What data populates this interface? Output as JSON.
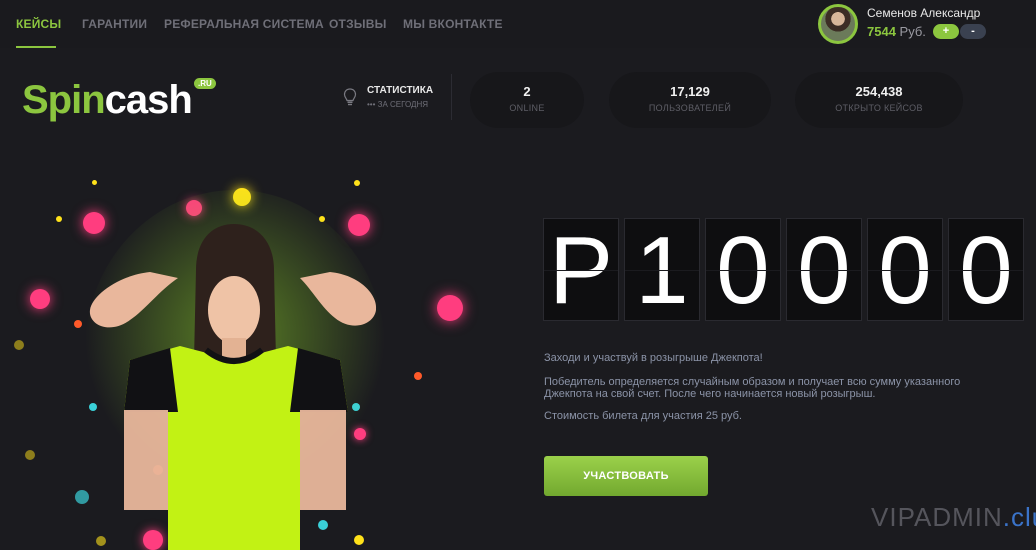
{
  "nav": {
    "items": [
      {
        "label": "КЕЙСЫ",
        "active": true
      },
      {
        "label": "ГАРАНТИИ",
        "active": false
      },
      {
        "label": "РЕФЕРАЛЬНАЯ СИСТЕМА",
        "active": false
      },
      {
        "label": "ОТЗЫВЫ",
        "active": false
      },
      {
        "label": "МЫ ВКОНТАКТЕ",
        "active": false
      }
    ]
  },
  "user": {
    "name": "Семенов Александр",
    "balance": "7544",
    "currency": "Руб.",
    "plus_label": "+",
    "minus_label": "-"
  },
  "logo": {
    "part1": "Spin",
    "part2": "cash",
    "badge": ".RU"
  },
  "stats": {
    "title": "СТАТИСТИКА",
    "subtitle": "••• ЗА СЕГОДНЯ",
    "items": [
      {
        "value": "2",
        "label": "ONLINE"
      },
      {
        "value": "17,129",
        "label": "ПОЛЬЗОВАТЕЛЕЙ"
      },
      {
        "value": "254,438",
        "label": "ОТКРЫТО КЕЙСОВ"
      }
    ]
  },
  "jackpot": {
    "digits": [
      "Р",
      "1",
      "0",
      "0",
      "0",
      "0"
    ],
    "line1": "Заходи и участвуй в розыгрыше Джекпота!",
    "line2a": "Победитель определяется случайным образом и получает всю сумму указанного",
    "line2b": "Джекпота на свой счет. После чего начинается новый розыгрыш.",
    "line3": "Стоимость билета для участия 25 руб.",
    "button": "УЧАСТВОВАТЬ"
  },
  "watermark": {
    "part1": "VIPADMIN",
    "part2": ".club"
  },
  "colors": {
    "accent": "#8cc63f",
    "background": "#1b1b1f",
    "text_muted": "#8b93a7"
  }
}
